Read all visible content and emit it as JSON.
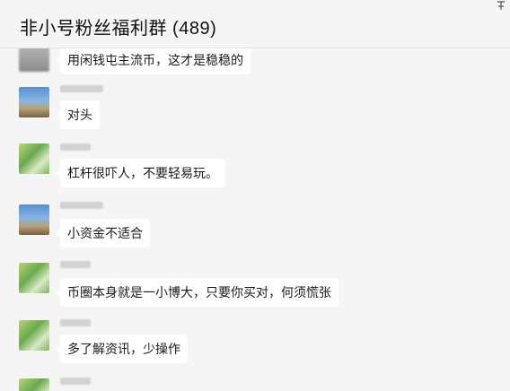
{
  "header": {
    "title": "非小号粉丝福利群 (489)"
  },
  "messages": [
    {
      "avatar": "gray-blurred",
      "text": "用闲钱屯主流币，这才是稳稳的"
    },
    {
      "avatar": "sky-landscape",
      "text": "对头"
    },
    {
      "avatar": "green-plant",
      "text": "杠杆很吓人，不要轻易玩。"
    },
    {
      "avatar": "sky-landscape",
      "text": "小资金不适合"
    },
    {
      "avatar": "green-plant",
      "text": "币圈本身就是一小博大，只要你买对，何须慌张"
    },
    {
      "avatar": "green-plant",
      "text": "多了解资讯，少操作"
    },
    {
      "avatar": "green-plant",
      "text": ""
    }
  ]
}
